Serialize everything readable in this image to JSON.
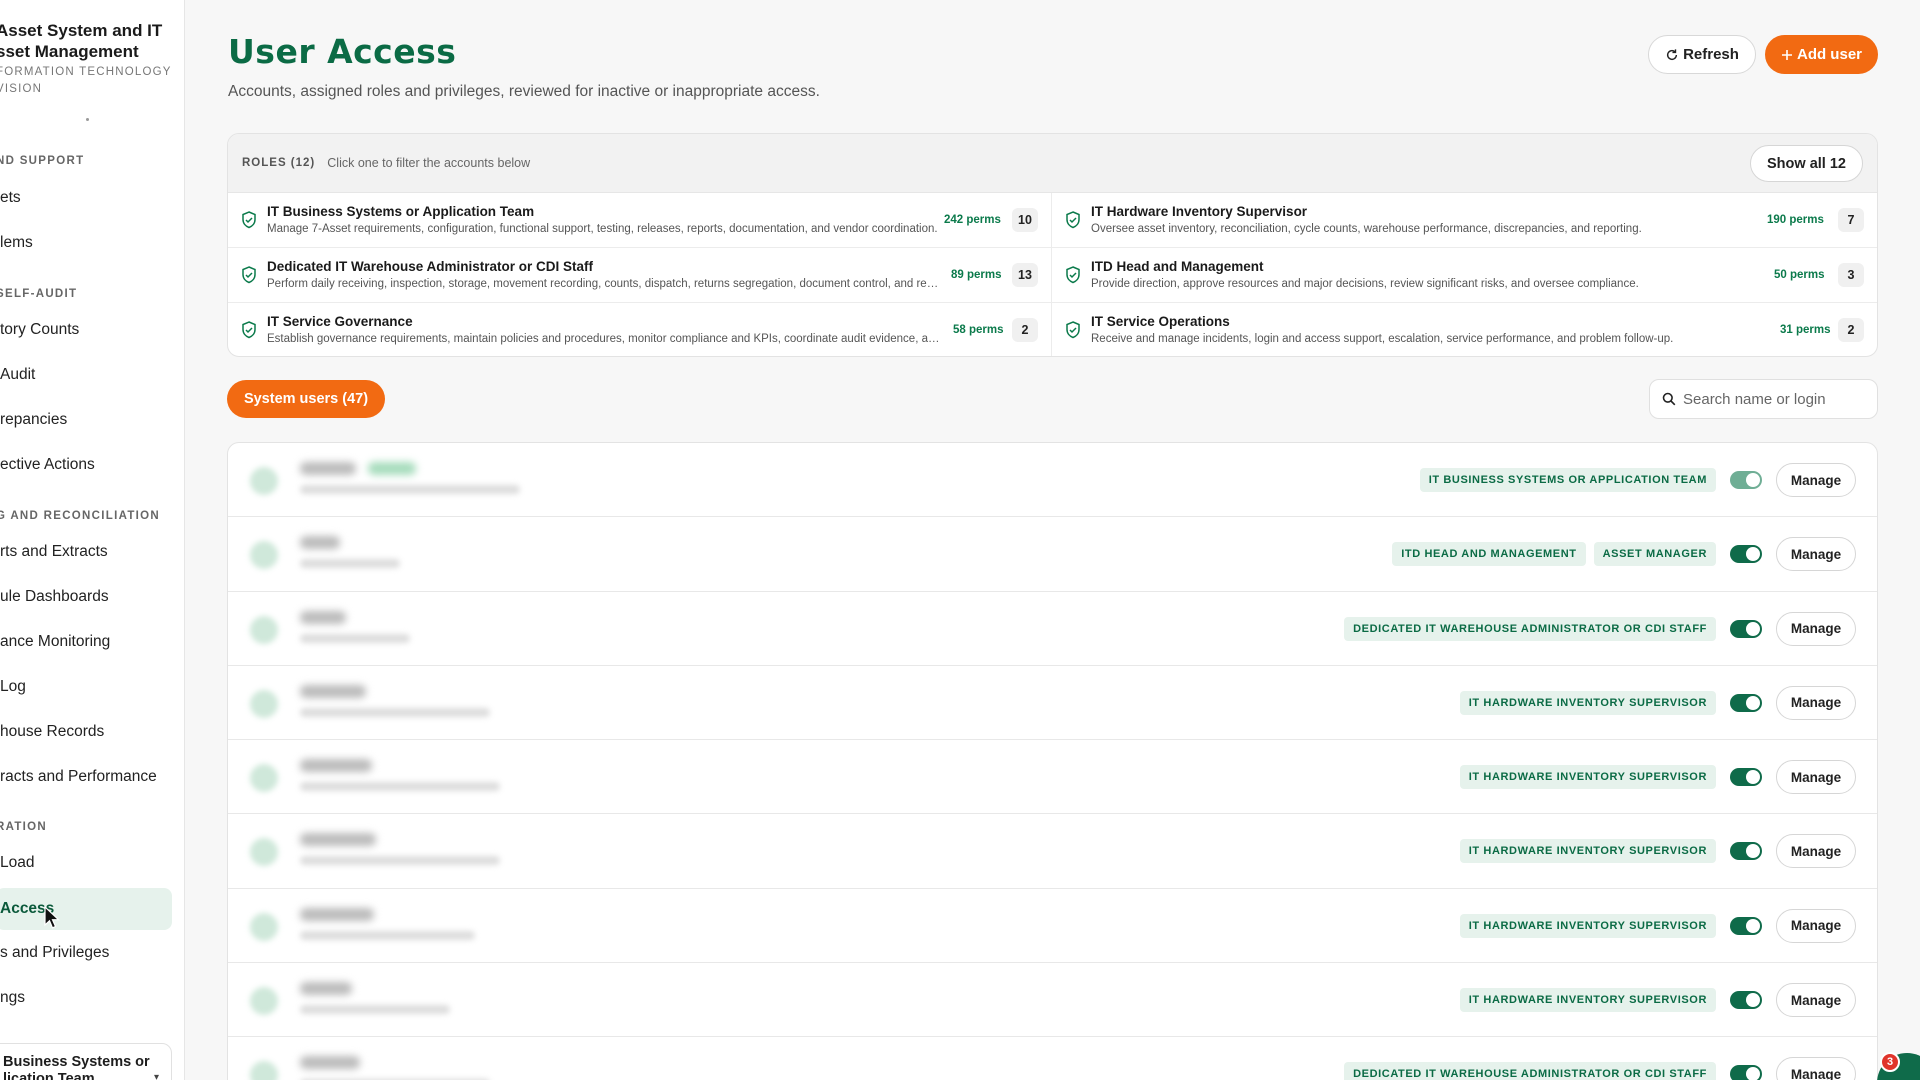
{
  "sidebar": {
    "brand_title": "Asset System and IT\nsset Management",
    "brand_sub": "FORMATION TECHNOLOGY\nVISION",
    "sections": [
      {
        "label": "ND SUPPORT"
      },
      {
        "label": " SELF-AUDIT"
      },
      {
        "label": "G AND RECONCILIATION"
      },
      {
        "label": "RATION"
      }
    ],
    "items": [
      {
        "label": "ets"
      },
      {
        "label": "lems"
      },
      {
        "label": "tory Counts"
      },
      {
        "label": "Audit"
      },
      {
        "label": "repancies"
      },
      {
        "label": "ective Actions"
      },
      {
        "label": "rts and Extracts"
      },
      {
        "label": "ule Dashboards"
      },
      {
        "label": "ance Monitoring"
      },
      {
        "label": " Log"
      },
      {
        "label": "house Records"
      },
      {
        "label": "racts and Performance"
      },
      {
        "label": "Load"
      },
      {
        "label": " Access"
      },
      {
        "label": "s and Privileges"
      },
      {
        "label": "ngs"
      }
    ],
    "role_switcher": "Business Systems or\nlication Team"
  },
  "header": {
    "title": "User Access",
    "subtitle": "Accounts, assigned roles and privileges, reviewed for inactive or inappropriate access.",
    "refresh_label": "Refresh",
    "add_user_label": "Add user"
  },
  "roles": {
    "label": "ROLES (12)",
    "hint": "Click one to filter the accounts below",
    "show_all_label": "Show all 12",
    "items": [
      {
        "name": "IT Business Systems or Application Team",
        "desc": "Manage 7-Asset requirements, configuration, functional support, testing, releases, reports, documentation, and vendor coordination.",
        "perms": "242 perms",
        "count": "10"
      },
      {
        "name": "IT Hardware Inventory Supervisor",
        "desc": "Oversee asset inventory, reconciliation, cycle counts, warehouse performance, discrepancies, and reporting.",
        "perms": "190 perms",
        "count": "7"
      },
      {
        "name": "Dedicated IT Warehouse Administrator or CDI Staff",
        "desc": "Perform daily receiving, inspection, storage, movement recording, counts, dispatch, returns segregation, document control, and records.",
        "perms": "89 perms",
        "count": "13"
      },
      {
        "name": "ITD Head and Management",
        "desc": "Provide direction, approve resources and major decisions, review significant risks, and oversee compliance.",
        "perms": "50 perms",
        "count": "3"
      },
      {
        "name": "IT Service Governance",
        "desc": "Establish governance requirements, maintain policies and procedures, monitor compliance and KPIs, coordinate audit evidence, and reviews.",
        "perms": "58 perms",
        "count": "2"
      },
      {
        "name": "IT Service Operations",
        "desc": "Receive and manage incidents, login and access support, escalation, service performance, and problem follow-up.",
        "perms": "31 perms",
        "count": "2"
      }
    ]
  },
  "users": {
    "tab_label": "System users (47)",
    "search_placeholder": "Search name or login",
    "manage_label": "Manage",
    "rows": [
      {
        "roles": [
          "IT BUSINESS SYSTEMS OR APPLICATION TEAM"
        ],
        "active": true
      },
      {
        "roles": [
          "ITD HEAD AND MANAGEMENT",
          "ASSET MANAGER"
        ],
        "active": true
      },
      {
        "roles": [
          "DEDICATED IT WAREHOUSE ADMINISTRATOR OR CDI STAFF"
        ],
        "active": true
      },
      {
        "roles": [
          "IT HARDWARE INVENTORY SUPERVISOR"
        ],
        "active": true
      },
      {
        "roles": [
          "IT HARDWARE INVENTORY SUPERVISOR"
        ],
        "active": true
      },
      {
        "roles": [
          "IT HARDWARE INVENTORY SUPERVISOR"
        ],
        "active": true
      },
      {
        "roles": [
          "IT HARDWARE INVENTORY SUPERVISOR"
        ],
        "active": true
      },
      {
        "roles": [
          "IT HARDWARE INVENTORY SUPERVISOR"
        ],
        "active": true
      },
      {
        "roles": [
          "DEDICATED IT WAREHOUSE ADMINISTRATOR OR CDI STAFF"
        ],
        "active": true
      }
    ]
  },
  "chat": {
    "badge": "3"
  },
  "colors": {
    "brand_green": "#0b6b45",
    "accent_orange": "#f26a12",
    "chip_bg": "#e6f2ec"
  },
  "icons": [
    "refresh-icon",
    "plus-icon",
    "shield-check-icon",
    "search-icon",
    "chevron-down-icon",
    "chat-icon",
    "cursor-icon"
  ]
}
